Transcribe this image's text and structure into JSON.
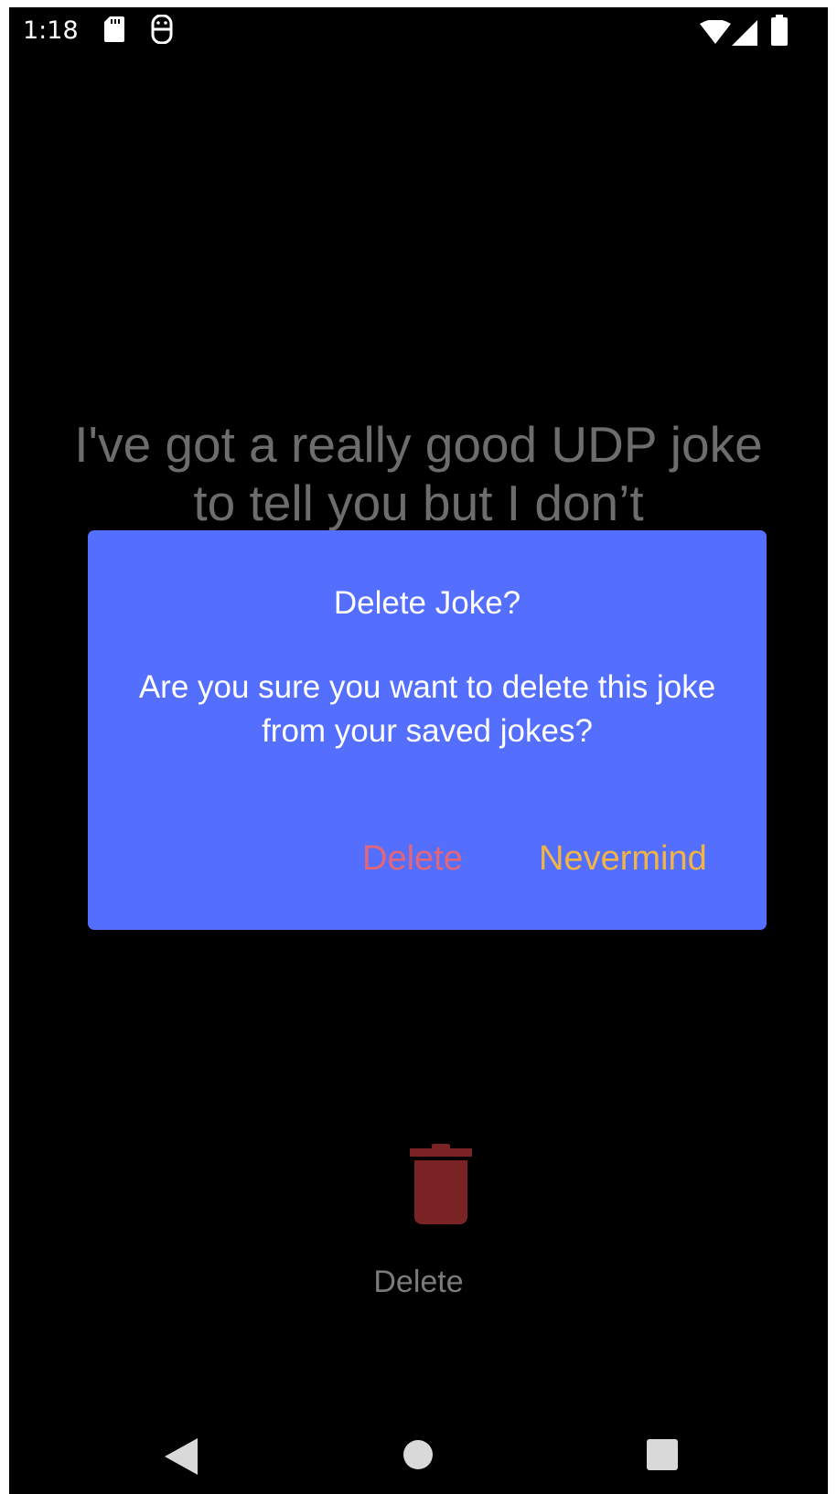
{
  "status_bar": {
    "time": "1:18",
    "icons": [
      "sd-card-icon",
      "s-notification-icon",
      "wifi-icon",
      "signal-icon",
      "battery-icon"
    ]
  },
  "joke": {
    "text": "I've got a really good UDP joke to tell you but I don’t"
  },
  "dialog": {
    "title": "Delete Joke?",
    "message": "Are you sure you want to delete this joke from your saved jokes?",
    "delete_label": "Delete",
    "nevermind_label": "Nevermind",
    "background_color": "#546ffd",
    "delete_color": "#e2667a",
    "nevermind_color": "#f2b545"
  },
  "bottom_action": {
    "icon": "trash-icon",
    "label": "Delete",
    "icon_color": "#7a2325"
  },
  "nav_bar": {
    "icons": [
      "back-icon",
      "home-icon",
      "recents-icon"
    ]
  }
}
